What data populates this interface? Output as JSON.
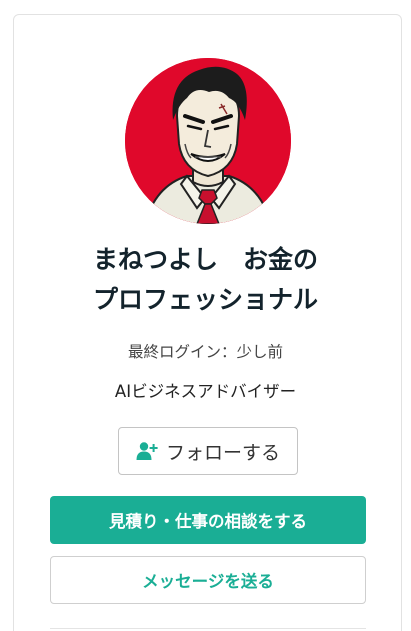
{
  "profile": {
    "name_line1": "まねつよし　お金の",
    "name_line2": "プロフェッショナル",
    "last_login": "最終ログイン：少し前",
    "title": "AIビジネスアドバイザー",
    "avatar_icon": "profile-portrait"
  },
  "actions": {
    "follow_label": "フォローする",
    "follow_icon": "person-plus-icon",
    "consult_label": "見積り・仕事の相談をする",
    "message_label": "メッセージを送る"
  },
  "colors": {
    "accent": "#1aae95",
    "avatar_background": "#e0082b",
    "name_text": "#13232c"
  }
}
